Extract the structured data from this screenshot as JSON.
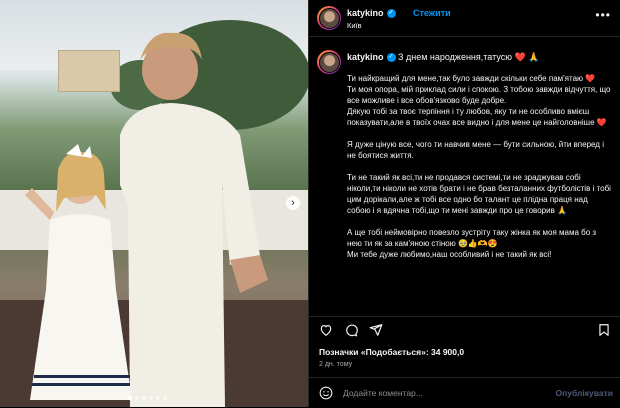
{
  "post": {
    "username": "katykino",
    "follow_label": "Стежити",
    "location": "Київ",
    "more_label": "•••"
  },
  "caption": {
    "username": "katykino",
    "first_line": "З днем народження,татусю",
    "first_line_emoji": "❤️ 🙏",
    "paragraphs": [
      "Ти найкращий для мене,так було завжди скільки себе пам'ятаю ❤️\nТи моя опора, мій приклад сили і спокою. З тобою завжди відчуття, що все можливе і все обов'язково буде добре.\nДякую тобі за твоє терпіння і ту любов, яку ти не особливо вмієш показувати,але в твоїх очах все видно і для мене це найголовніше ❤️",
      "Я дуже ціную все, чого ти навчив мене — бути сильною, йти вперед і не боятися життя.",
      "Ти не такий як всі,ти не продався системі,ти не зраджував собі ніколи,ти ніколи не хотів брати і не брав безталанних футболістів і тобі цим дорікали,але ж тобі все одно бо талант це плідна праця над собою і я вдячна тобі,що ти мені завжди про це говорив 🙏",
      "А ще тобі неймовірно повезло зустріту таку жінка як моя мама бо з нею ти як за кам'яною стіною 🥹👍🫶😍\nМи тебе дуже любимо,наш особливий і не такий як всі!"
    ]
  },
  "likes": {
    "label": "Позначки «Подобається»: 34 900,0"
  },
  "time": {
    "ago": "2 дн. тому"
  },
  "comment": {
    "placeholder": "Додайте коментар...",
    "publish_label": "Опублікувати"
  },
  "icons": {
    "like": "heart-icon",
    "comment": "comment-icon",
    "share": "send-icon",
    "save": "bookmark-icon",
    "emoji": "emoji-icon",
    "verified": "verified-badge-icon",
    "next": "chevron-right-icon"
  },
  "colors": {
    "accent": "#0095f6",
    "heart": "#ff3040",
    "background": "#000000"
  },
  "carousel": {
    "slide_count": 6,
    "active_index": 0
  }
}
